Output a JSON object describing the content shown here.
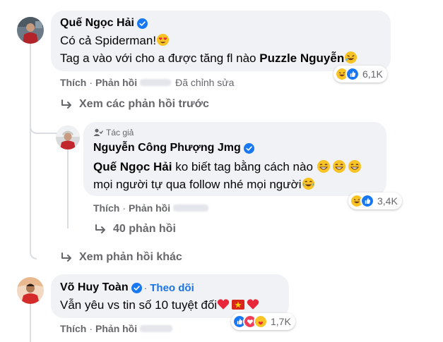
{
  "comments": [
    {
      "author": "Quế Ngọc Hải",
      "line1": "Có cả Spiderman!",
      "line2_prefix": "Tag a vào với cho a được tăng fl nào ",
      "line2_mention": "Puzzle Nguyễn",
      "like_label": "Thích",
      "reply_label": "Phản hồi",
      "edited_label": "Đã chỉnh sửa",
      "reaction_count": "6,1K"
    },
    {
      "author_badge": "Tác giả",
      "author": "Nguyễn Công Phượng Jmg",
      "mention": "Quế Ngọc Hải",
      "line1_rest": " ko biết tag bằng cách nào ",
      "line2": "mọi người tự qua follow nhé mọi người",
      "like_label": "Thích",
      "reply_label": "Phản hồi",
      "reaction_count": "3,4K"
    },
    {
      "author": "Võ Huy Toàn",
      "follow_label": "Theo dõi",
      "line1": "Vẫn yêu vs tin số 10 tuyệt đối",
      "like_label": "Thích",
      "reply_label": "Phản hồi",
      "reaction_count": "1,7K"
    }
  ],
  "links": {
    "previous_replies": "Xem các phản hồi trước",
    "replies_count": "40 phản hồi",
    "more_replies": "Xem phản hồi khác"
  },
  "icons": {
    "reply_arrow": "reply-arrow-icon",
    "verified": "verified-badge-icon",
    "laugh": "haha-reaction-icon",
    "like": "like-reaction-icon",
    "love": "love-reaction-icon"
  },
  "colors": {
    "bubble": "#f0f2f5",
    "secondary_text": "#65676b",
    "link_blue": "#1b74e4",
    "verified_blue": "#1877f2"
  }
}
